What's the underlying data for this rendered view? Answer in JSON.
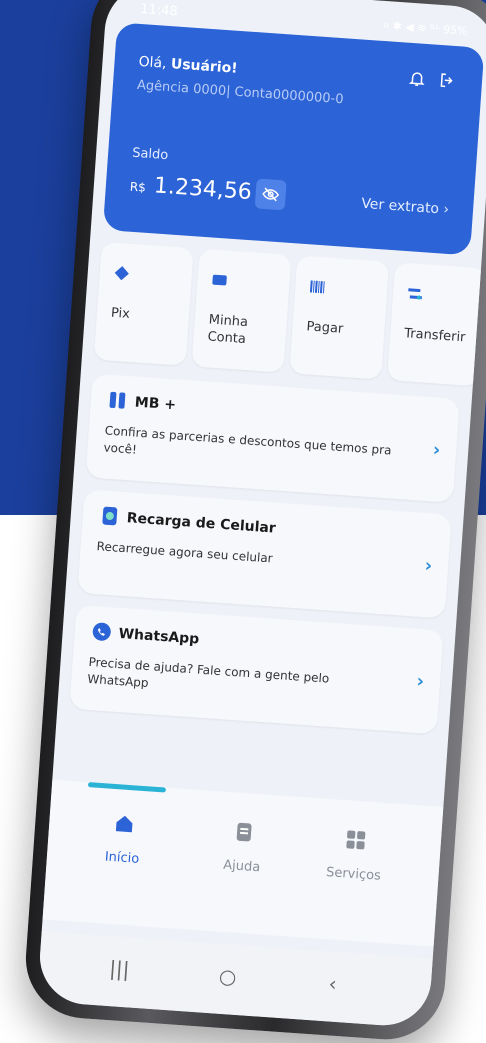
{
  "status": {
    "time": "11:48",
    "icons": "⌗ ✱ ◀ ≋ ᴵᴸᴸ 95%"
  },
  "header": {
    "greeting_prefix": "Olá, ",
    "user_name": "Usuário!",
    "account_line": "Agência 0000| Conta0000000-0",
    "saldo_label": "Saldo",
    "currency": "R$",
    "balance": "1.234,56",
    "statement_link": "Ver extrato ›"
  },
  "shortcuts": [
    {
      "label": "Pix",
      "icon": "pix-icon"
    },
    {
      "label": "Minha Conta",
      "icon": "wallet-icon"
    },
    {
      "label": "Pagar",
      "icon": "barcode-icon"
    },
    {
      "label": "Transferir",
      "icon": "transfer-icon"
    }
  ],
  "cards": [
    {
      "title": "MB +",
      "desc": "Confira as parcerias e descontos que temos pra você!",
      "icon": "mb-plus-icon"
    },
    {
      "title": "Recarga de Celular",
      "desc": "Recarregue agora seu celular",
      "icon": "mobile-recharge-icon"
    },
    {
      "title": "WhatsApp",
      "desc": "Precisa de ajuda? Fale com a gente pelo WhatsApp",
      "icon": "whatsapp-icon"
    }
  ],
  "tabs": [
    {
      "label": "Início",
      "icon": "home-icon",
      "active": true
    },
    {
      "label": "Ajuda",
      "icon": "help-doc-icon",
      "active": false
    },
    {
      "label": "Serviços",
      "icon": "grid-icon",
      "active": false
    }
  ],
  "navbar": {
    "recents": "|||",
    "home": "○",
    "back": "‹"
  },
  "colors": {
    "brand_blue": "#2c63d6",
    "background_blue": "#1b3f9c",
    "accent_cyan": "#2bb3d6"
  }
}
